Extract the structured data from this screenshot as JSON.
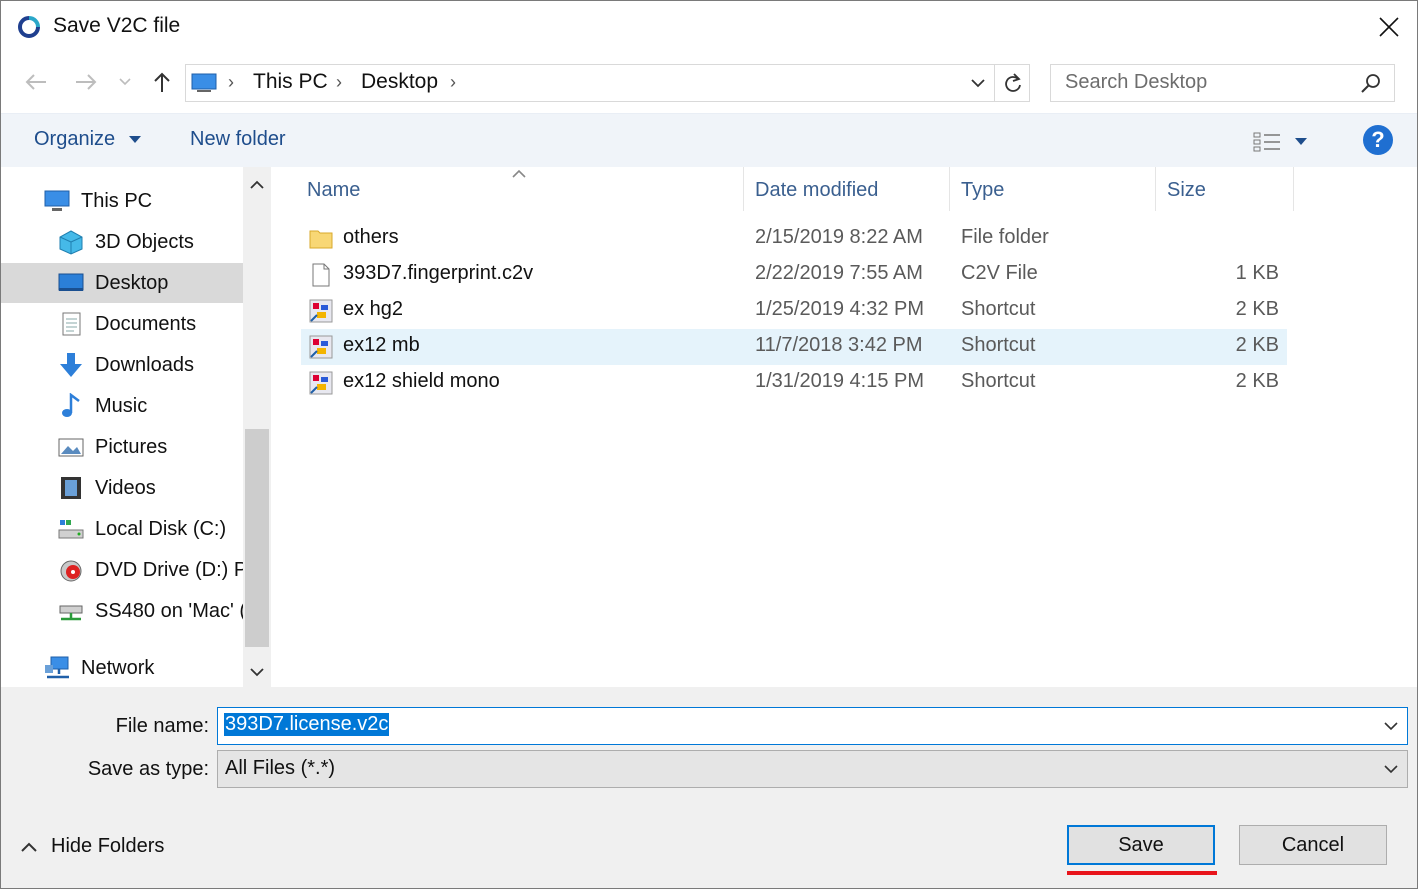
{
  "window": {
    "title": "Save V2C file"
  },
  "address": {
    "crumbs": [
      "This PC",
      "Desktop"
    ]
  },
  "search": {
    "placeholder": "Search Desktop"
  },
  "toolbar": {
    "organize": "Organize",
    "new_folder": "New folder",
    "help": "?"
  },
  "sidebar": {
    "items": [
      {
        "label": "This PC",
        "icon": "this-pc-icon"
      },
      {
        "label": "3D Objects",
        "icon": "3d-objects-icon"
      },
      {
        "label": "Desktop",
        "icon": "desktop-icon",
        "selected": true
      },
      {
        "label": "Documents",
        "icon": "documents-icon"
      },
      {
        "label": "Downloads",
        "icon": "downloads-icon"
      },
      {
        "label": "Music",
        "icon": "music-icon"
      },
      {
        "label": "Pictures",
        "icon": "pictures-icon"
      },
      {
        "label": "Videos",
        "icon": "videos-icon"
      },
      {
        "label": "Local Disk (C:)",
        "icon": "local-disk-icon"
      },
      {
        "label": "DVD Drive (D:) P",
        "icon": "dvd-drive-icon"
      },
      {
        "label": "SS480 on 'Mac' (",
        "icon": "network-drive-icon"
      },
      {
        "label": "Network",
        "icon": "network-icon"
      }
    ]
  },
  "columns": {
    "name": "Name",
    "date": "Date modified",
    "type": "Type",
    "size": "Size"
  },
  "files": [
    {
      "name": "others",
      "date": "2/15/2019 8:22 AM",
      "type": "File folder",
      "size": "",
      "icon": "folder-icon"
    },
    {
      "name": "393D7.fingerprint.c2v",
      "date": "2/22/2019 7:55 AM",
      "type": "C2V File",
      "size": "1 KB",
      "icon": "file-icon"
    },
    {
      "name": "ex hg2",
      "date": "1/25/2019 4:32 PM",
      "type": "Shortcut",
      "size": "2 KB",
      "icon": "shortcut-icon"
    },
    {
      "name": "ex12 mb",
      "date": "11/7/2018 3:42 PM",
      "type": "Shortcut",
      "size": "2 KB",
      "icon": "shortcut-icon",
      "highlighted": true
    },
    {
      "name": "ex12 shield mono",
      "date": "1/31/2019 4:15 PM",
      "type": "Shortcut",
      "size": "2 KB",
      "icon": "shortcut-icon"
    }
  ],
  "form": {
    "filename_label": "File name:",
    "filename_value": "393D7.license.v2c",
    "type_label": "Save as type:",
    "type_value": "All Files (*.*)"
  },
  "footer": {
    "hide_folders": "Hide Folders",
    "save": "Save",
    "cancel": "Cancel"
  },
  "colors": {
    "accent": "#0078d7",
    "link": "#1e4d8c",
    "highlight_row": "#e5f3fb",
    "annotation_red": "#e8141b"
  }
}
